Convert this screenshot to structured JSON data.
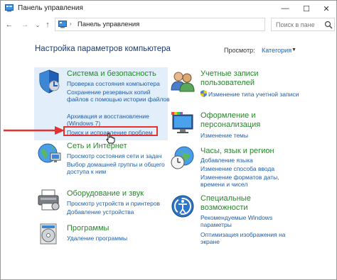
{
  "window": {
    "title": "Панель управления",
    "controls": {
      "minimize": "—",
      "maximize": "☐",
      "close": "✕"
    }
  },
  "address": {
    "path": "Панель управления",
    "search_placeholder": "Поиск в пане"
  },
  "main": {
    "heading": "Настройка параметров компьютера",
    "view_by_label": "Просмотр:",
    "view_by_value": "Категория"
  },
  "categories": {
    "system": {
      "icon": "shield-icon",
      "title": "Система и безопасность",
      "links": [
        "Проверка состояния компьютера",
        "Сохранение резервных копий файлов с помощью истории файлов",
        "Архивация и восстановление (Windows 7)",
        "Поиск и исправление проблем"
      ]
    },
    "network": {
      "icon": "network-globe-icon",
      "title": "Сеть и Интернет",
      "links": [
        "Просмотр состояния сети и задач",
        "Выбор домашней группы и общего доступа к ним"
      ]
    },
    "hardware": {
      "icon": "printer-icon",
      "title": "Оборудование и звук",
      "links": [
        "Просмотр устройств и принтеров",
        "Добавление устройства"
      ]
    },
    "programs": {
      "icon": "programs-disc-icon",
      "title": "Программы",
      "links": [
        "Удаление программы"
      ]
    },
    "accounts": {
      "icon": "users-icon",
      "title": "Учетные записи пользователей",
      "links": [
        "Изменение типа учетной записи"
      ]
    },
    "appearance": {
      "icon": "monitor-palette-icon",
      "title": "Оформление и персонализация",
      "links": [
        "Изменение темы"
      ]
    },
    "clock": {
      "icon": "clock-globe-icon",
      "title": "Часы, язык и регион",
      "links": [
        "Добавление языка",
        "Изменение способа ввода",
        "Изменение форматов даты, времени и чисел"
      ]
    },
    "access": {
      "icon": "ease-of-access-icon",
      "title": "Специальные возможности",
      "links": [
        "Рекомендуемые Windows параметры",
        "Оптимизация изображения на экране"
      ]
    }
  },
  "colors": {
    "category_title": "#26882a",
    "link": "#1f5ea8",
    "highlight": "#e53131",
    "selected_bg": "#e2eef9"
  }
}
